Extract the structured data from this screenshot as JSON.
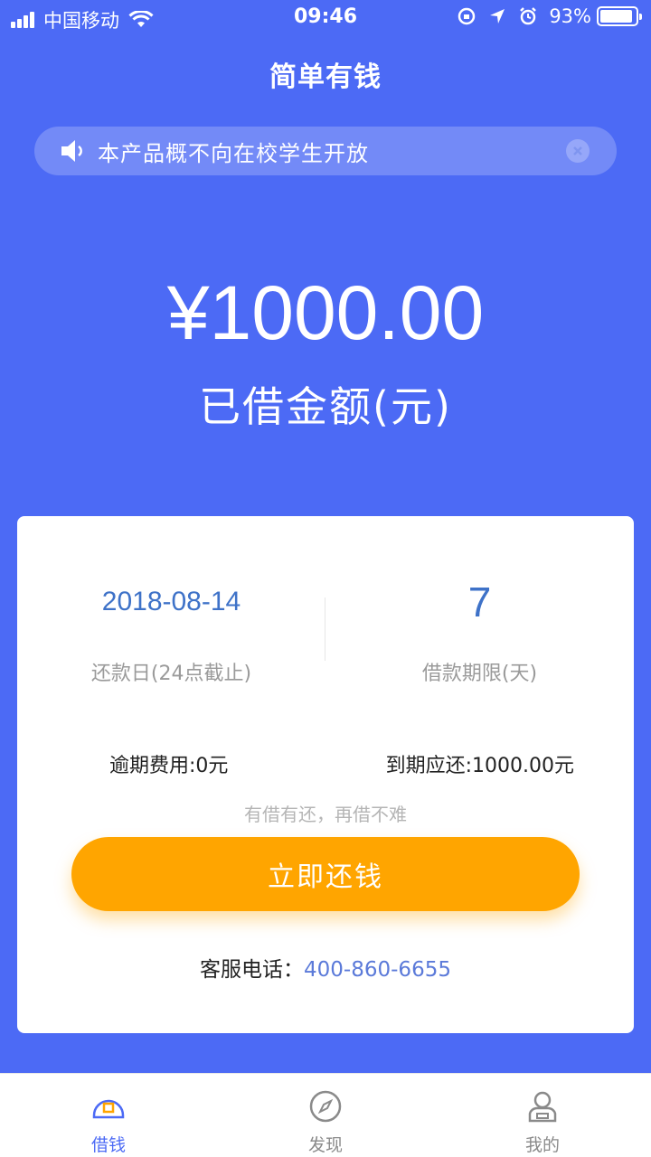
{
  "status_bar": {
    "carrier": "中国移动",
    "time": "09:46",
    "battery_percent": "93%",
    "battery_level": 0.93
  },
  "header": {
    "title": "简单有钱"
  },
  "notice": {
    "text": "本产品概不向在校学生开放",
    "icon": "speaker-icon"
  },
  "loan": {
    "amount": "¥1000.00",
    "amount_label": "已借金额(元)"
  },
  "card": {
    "due_date": "2018-08-14",
    "due_date_label": "还款日(24点截止)",
    "term": "7",
    "term_label": "借款期限(天)",
    "overdue_fee": "逾期费用:0元",
    "due_total": "到期应还:1000.00元",
    "slogan": "有借有还，再借不难",
    "repay_button": "立即还钱",
    "service_label": "客服电话：",
    "service_phone": "400-860-6655"
  },
  "tabs": [
    {
      "label": "借钱",
      "icon": "borrow-icon",
      "active": true
    },
    {
      "label": "发现",
      "icon": "compass-icon",
      "active": false
    },
    {
      "label": "我的",
      "icon": "profile-icon",
      "active": false
    }
  ],
  "colors": {
    "primary": "#4c6af5",
    "accent": "#ffa500",
    "link": "#3e72c8"
  }
}
